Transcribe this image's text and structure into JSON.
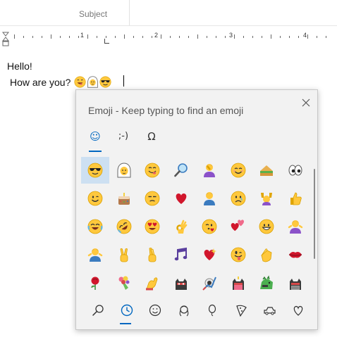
{
  "header": {
    "subject_label": "Subject"
  },
  "ruler": {
    "numbers": [
      "1",
      "2",
      "3",
      "4"
    ]
  },
  "document": {
    "line1": "Hello!",
    "line2": "How are you?",
    "inline_emojis": [
      "grinning-face-icon",
      "woman-with-headscarf-icon",
      "smiling-face-with-sunglasses-icon"
    ]
  },
  "emoji_panel": {
    "title": "Emoji - Keep typing to find an emoji",
    "close_icon": "close-icon",
    "category_tabs": [
      {
        "name": "tab-emoji",
        "glyph": "☺",
        "active": true
      },
      {
        "name": "tab-kaomoji",
        "glyph": ";-)",
        "active": false
      },
      {
        "name": "tab-symbols",
        "glyph": "Ω",
        "active": false
      }
    ],
    "grid": [
      [
        "smiling-face-with-sunglasses-icon",
        "woman-with-headscarf-icon",
        "face-savoring-food-icon",
        "magnifying-glass-icon",
        "person-facepalming-icon",
        "smiling-face-with-smiling-eyes-icon",
        "sandwich-icon",
        "eyes-icon"
      ],
      [
        "winking-face-icon",
        "birthday-cake-icon",
        "unamused-face-icon",
        "red-heart-icon",
        "person-facepalming-man-icon",
        "sad-face-icon",
        "person-raising-hands-icon",
        "thumbs-up-icon"
      ],
      [
        "face-with-tears-of-joy-icon",
        "rolling-on-floor-laughing-icon",
        "heart-eyes-face-icon",
        "ok-hand-icon",
        "face-blowing-kiss-icon",
        "two-hearts-icon",
        "grinning-face-with-big-eyes-icon",
        "person-shrugging-icon"
      ],
      [
        "person-shrugging-man-icon",
        "victory-hand-icon",
        "crossed-fingers-icon",
        "musical-notes-icon",
        "sparkling-heart-icon",
        "winking-face-with-tongue-icon",
        "clapping-hands-icon",
        "kiss-mark-icon"
      ],
      [
        "rose-icon",
        "bouquet-icon",
        "flexed-biceps-icon",
        "ninja-cat-icon",
        "astronaut-cat-icon",
        "birthday-ninja-cat-icon",
        "dinosaur-cat-icon",
        "hacker-cat-icon"
      ]
    ],
    "selected_cell": "smiling-face-with-sunglasses-icon",
    "bottom_tabs": [
      {
        "name": "search-icon",
        "active": false
      },
      {
        "name": "recent-clock-icon",
        "active": true
      },
      {
        "name": "smiley-outline-icon",
        "active": false
      },
      {
        "name": "person-outline-icon",
        "active": false
      },
      {
        "name": "balloon-icon",
        "active": false
      },
      {
        "name": "pizza-slice-icon",
        "active": false
      },
      {
        "name": "car-icon",
        "active": false
      },
      {
        "name": "heart-outline-icon",
        "active": false
      }
    ]
  },
  "colors": {
    "accent": "#0067c0",
    "panel_bg": "#f2f2f2",
    "selected_bg": "#cde0f2",
    "emoji_yellow": "#ffc83d",
    "heart_red": "#d1162c"
  }
}
